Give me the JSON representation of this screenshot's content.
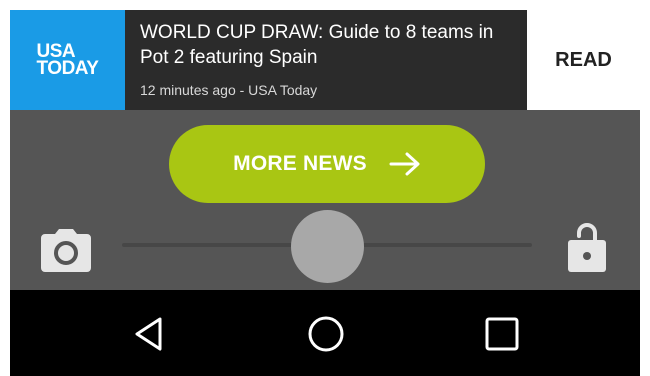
{
  "notification": {
    "logo_line1": "USA",
    "logo_line2": "TODAY",
    "headline": "WORLD CUP DRAW: Guide to 8 teams in Pot 2 featuring Spain",
    "meta": "12 minutes ago - USA Today",
    "action_label": "READ"
  },
  "more_news": {
    "label": "MORE NEWS",
    "icon": "arrow-right-icon"
  },
  "lockscreen": {
    "left_icon": "camera-icon",
    "right_icon": "unlock-icon",
    "slider_icon": "unlock-slider-knob"
  },
  "navbar": {
    "items": [
      "back-icon",
      "home-icon",
      "recents-icon"
    ]
  },
  "colors": {
    "usa_today_blue": "#1a9be6",
    "accent_green": "#a9c613",
    "background": "#555555",
    "navbar": "#000000"
  }
}
